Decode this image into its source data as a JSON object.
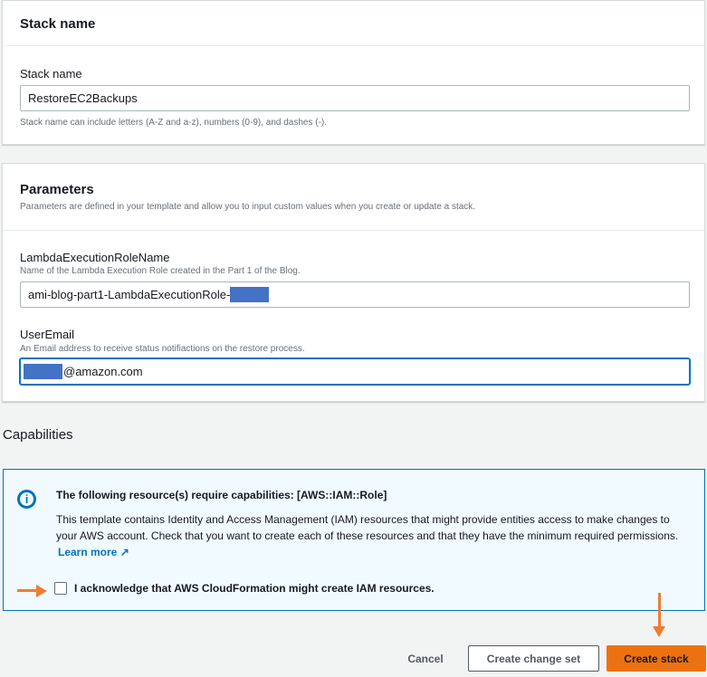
{
  "stack_panel": {
    "title": "Stack name",
    "label": "Stack name",
    "value": "RestoreEC2Backups",
    "hint": "Stack name can include letters (A-Z and a-z), numbers (0-9), and dashes (-)."
  },
  "parameters_panel": {
    "title": "Parameters",
    "description": "Parameters are defined in your template and allow you to input custom values when you create or update a stack.",
    "fields": [
      {
        "label": "LambdaExecutionRoleName",
        "description": "Name of the Lambda Execution Role created in the Part 1 of the Blog.",
        "value": "ami-blog-part1-LambdaExecutionRole-"
      },
      {
        "label": "UserEmail",
        "description": "An Email address to receive status notifiactions on the restore process.",
        "value": "@amazon.com"
      }
    ]
  },
  "capabilities": {
    "title": "Capabilities",
    "info_title": "The following resource(s) require capabilities: [AWS::IAM::Role]",
    "info_body": "This template contains Identity and Access Management (IAM) resources that might provide entities access to make changes to your AWS account. Check that you want to create each of these resources and that they have the minimum required permissions.",
    "learn_more": "Learn more",
    "acknowledge": "I acknowledge that AWS CloudFormation might create IAM resources."
  },
  "actions": {
    "cancel": "Cancel",
    "change_set": "Create change set",
    "create": "Create stack"
  },
  "colors": {
    "primary": "#ec7211",
    "info": "#0073bb",
    "annotation": "#ed7d31"
  }
}
